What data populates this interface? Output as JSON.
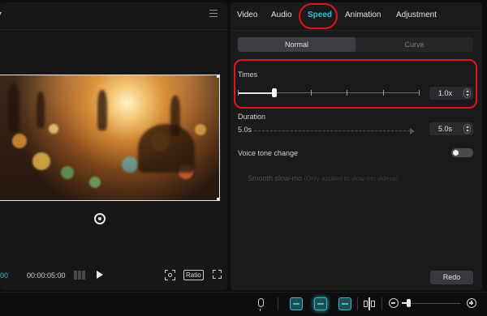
{
  "preview": {
    "timecode_current": "00",
    "timecode_total": "00:00:05:00",
    "ratio_label": "Ratio"
  },
  "tabs": [
    {
      "label": "Video"
    },
    {
      "label": "Audio"
    },
    {
      "label": "Speed",
      "active": true
    },
    {
      "label": "Animation"
    },
    {
      "label": "Adjustment"
    }
  ],
  "speed": {
    "modes": [
      "Normal",
      "Curve"
    ],
    "selected_mode": "Normal",
    "times_label": "Times",
    "times_value": "1.0x",
    "times_slider_fraction": 0.2,
    "duration_label": "Duration",
    "duration_start": "5.0s",
    "duration_value": "5.0s",
    "voice_tone_label": "Voice tone change",
    "voice_tone_enabled": false,
    "smooth_label": "Smooth slow-mo",
    "smooth_hint": "(Only applied to slow-mo videos)"
  },
  "actions": {
    "redo_label": "Redo"
  },
  "toolbar": {
    "icons": [
      "mic-icon",
      "link-clip-icon",
      "snap-icon",
      "preview-axis-icon",
      "split-icon",
      "zoom-out-icon",
      "zoom-in-icon"
    ],
    "zoom_fraction": 0.1
  },
  "colors": {
    "accent": "#2fc3d2",
    "highlight_ring": "#e1131c",
    "panel_bg": "#1a1a1d"
  }
}
